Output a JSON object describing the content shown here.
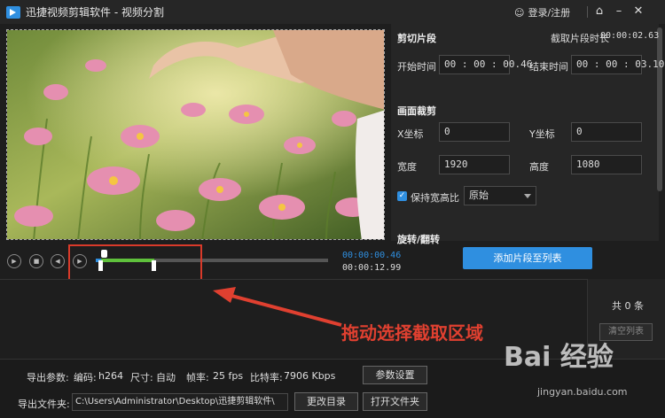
{
  "titlebar": {
    "title": "迅捷视频剪辑软件 - 视频分割",
    "login_label": "登录/注册"
  },
  "clip_panel": {
    "section_title": "剪切片段",
    "duration_label": "截取片段时长",
    "duration_value": "00:00:02.63",
    "start_label": "开始时间",
    "start_value": "00 : 00 : 00.46",
    "end_label": "结束时间",
    "end_value": "00 : 00 : 03.10"
  },
  "crop_panel": {
    "section_title": "画面裁剪",
    "x_label": "X坐标",
    "x_value": "0",
    "y_label": "Y坐标",
    "y_value": "0",
    "width_label": "宽度",
    "width_value": "1920",
    "height_label": "高度",
    "height_value": "1080",
    "keep_ratio_label": "保持宽高比",
    "keep_ratio_checked": true,
    "ratio_option": "原始"
  },
  "rotate_panel": {
    "section_title": "旋转/翻转"
  },
  "player": {
    "current_time": "00:00:00.46",
    "total_time": "00:00:12.99",
    "selection_start_fraction": 0.035,
    "selection_end_fraction": 0.238
  },
  "add_button_label": "添加片段至列表",
  "list": {
    "count_label": "共 0 条",
    "clear_label": "清空列表"
  },
  "annotation": {
    "text": "拖动选择截取区域",
    "color": "#e04030"
  },
  "export": {
    "params_label": "导出参数:",
    "codec_label": "编码:",
    "codec_value": "h264",
    "size_label": "尺寸:",
    "size_value": "自动",
    "fps_label": "帧率:",
    "fps_value": "25 fps",
    "bitrate_label": "比特率:",
    "bitrate_value": "7906 Kbps",
    "settings_button": "参数设置",
    "folder_label": "导出文件夹:",
    "folder_path": "C:\\Users\\Administrator\\Desktop\\迅捷剪辑软件\\",
    "change_dir_button": "更改目录",
    "open_folder_button": "打开文件夹"
  },
  "watermark": {
    "logo": "Bai 经验",
    "url": "jingyan.baidu.com"
  },
  "colors": {
    "accent": "#2f8fe0",
    "selection": "#5fc13c",
    "annotation": "#d93a2a"
  }
}
